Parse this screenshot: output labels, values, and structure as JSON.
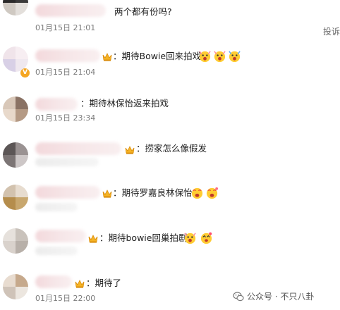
{
  "report_label": "投诉",
  "watermark": {
    "text": "公众号 · 不只八卦"
  },
  "comments": [
    {
      "text": "两个都有份吗?",
      "time": "01月15日 21:01"
    },
    {
      "text": "：期待Bowie回来拍戏",
      "time": "01月15日 21:04"
    },
    {
      "text": "：期待林保怡返来拍戏",
      "time": "01月15日 23:34"
    },
    {
      "text": "：捞家怎么像假发",
      "time": ""
    },
    {
      "text": "：期待罗嘉良林保怡",
      "time": ""
    },
    {
      "text": "：期待bowie回巢拍剧",
      "time": ""
    },
    {
      "text": "：期待了",
      "time": "01月15日 22:00"
    }
  ],
  "icons": {
    "crown": "crown-icon",
    "vip": "vip-badge-icon",
    "emoji": "excited-face-emoji",
    "watermark": "wechat-icon"
  }
}
